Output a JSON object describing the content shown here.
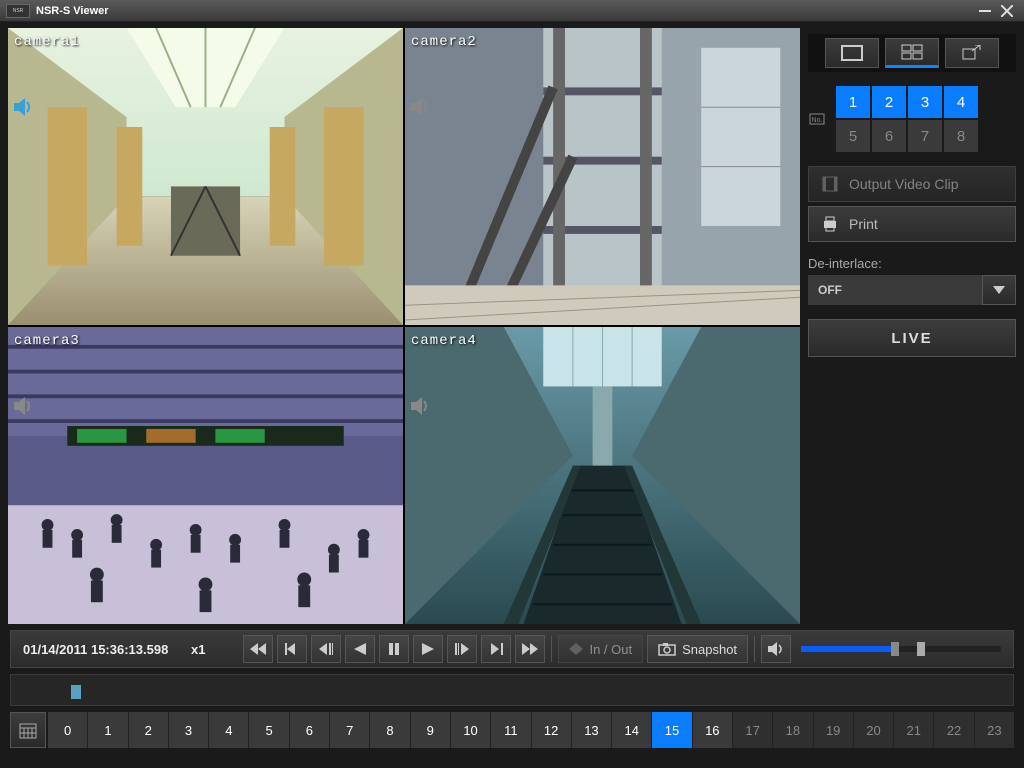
{
  "window": {
    "title": "NSR-S Viewer"
  },
  "cameras": [
    {
      "label": "camera1"
    },
    {
      "label": "camera2"
    },
    {
      "label": "camera3"
    },
    {
      "label": "camera4"
    }
  ],
  "side": {
    "cameraNumbers": [
      "1",
      "2",
      "3",
      "4",
      "5",
      "6",
      "7",
      "8"
    ],
    "activeCams": [
      0,
      1,
      2,
      3
    ],
    "outputVideoClip": "Output Video Clip",
    "print": "Print",
    "deinterlaceLabel": "De-interlace:",
    "deinterlaceValue": "OFF",
    "live": "LIVE"
  },
  "playback": {
    "timestamp": "01/14/2011 15:36:13.598",
    "speed": "x1",
    "inout": "In / Out",
    "snapshot": "Snapshot"
  },
  "hours": [
    "0",
    "1",
    "2",
    "3",
    "4",
    "5",
    "6",
    "7",
    "8",
    "9",
    "10",
    "11",
    "12",
    "13",
    "14",
    "15",
    "16",
    "17",
    "18",
    "19",
    "20",
    "21",
    "22",
    "23"
  ],
  "hoursRecorded": [
    0,
    1,
    2,
    3,
    4,
    5,
    6,
    7,
    8,
    9,
    10,
    11,
    12,
    13,
    14,
    15,
    16
  ],
  "hourSelected": 15
}
